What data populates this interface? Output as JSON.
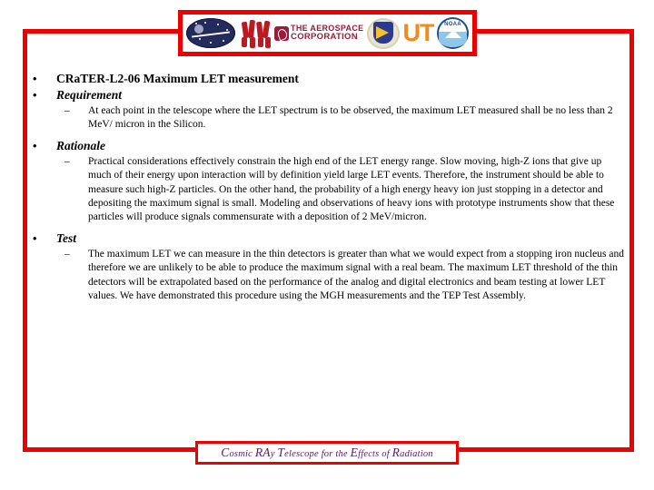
{
  "header": {
    "logos": [
      {
        "name": "nasa-seal-logo",
        "label": "NASA"
      },
      {
        "name": "unh-figures-logo",
        "label": "UNH"
      },
      {
        "name": "aerospace-corporation-logo",
        "line1": "THE AEROSPACE",
        "line2": "CORPORATION"
      },
      {
        "name": "air-force-research-laboratory-logo",
        "label": "AFRL"
      },
      {
        "name": "university-of-tennessee-logo",
        "label": "UT"
      },
      {
        "name": "noaa-logo",
        "label": "NOAA"
      }
    ]
  },
  "slide": {
    "bullets": [
      {
        "label": "CRaTER-L2-06 Maximum LET measurement",
        "style": "bold",
        "sub": []
      },
      {
        "label": "Requirement",
        "style": "bold-italic",
        "sub": [
          "At each point in the telescope where the LET spectrum is to be observed, the maximum LET measured shall be no less than 2 MeV/ micron in the Silicon."
        ]
      },
      {
        "label": "Rationale",
        "style": "bold-italic",
        "sub": [
          "Practical considerations effectively constrain the high end of the LET energy range. Slow moving, high-Z ions that give up much of their energy upon interaction will by definition yield large LET events. Therefore, the instrument should be able to measure such high-Z particles. On the other hand, the probability of a high energy heavy ion just stopping in a detector and depositing the maximum signal is small.  Modeling and observations of heavy ions with prototype instruments show that these particles will produce signals commensurate with a deposition of 2 MeV/micron."
        ]
      },
      {
        "label": "Test",
        "style": "bold-italic",
        "sub": [
          "The maximum LET we can measure in the thin detectors is greater than what we would expect from a stopping iron nucleus and therefore we are unlikely to be able to produce the maximum signal with a real beam.  The maximum LET threshold of the thin detectors will be extrapolated based on the performance of the analog and digital electronics and beam testing at lower LET values.  We have demonstrated this procedure using the MGH measurements and the TEP Test Assembly."
        ]
      }
    ],
    "bullet_glyph": "•",
    "dash_glyph": "–"
  },
  "footer": {
    "full_text": "Cosmic RAy Telescope for the Effects of Radiation",
    "parts": [
      {
        "t": "C",
        "cap": true
      },
      {
        "t": "osmic ",
        "cap": false
      },
      {
        "t": "RA",
        "cap": true
      },
      {
        "t": "y ",
        "cap": false
      },
      {
        "t": "T",
        "cap": true
      },
      {
        "t": "elescope for the ",
        "cap": false
      },
      {
        "t": "E",
        "cap": true
      },
      {
        "t": "ffects of ",
        "cap": false
      },
      {
        "t": "R",
        "cap": true
      },
      {
        "t": "adiation",
        "cap": false
      }
    ]
  },
  "colors": {
    "frame_red": "#EE0000",
    "footer_purple": "#5B1A6E",
    "ut_orange": "#F28A1E",
    "aerospace_maroon": "#9B1B3A"
  }
}
